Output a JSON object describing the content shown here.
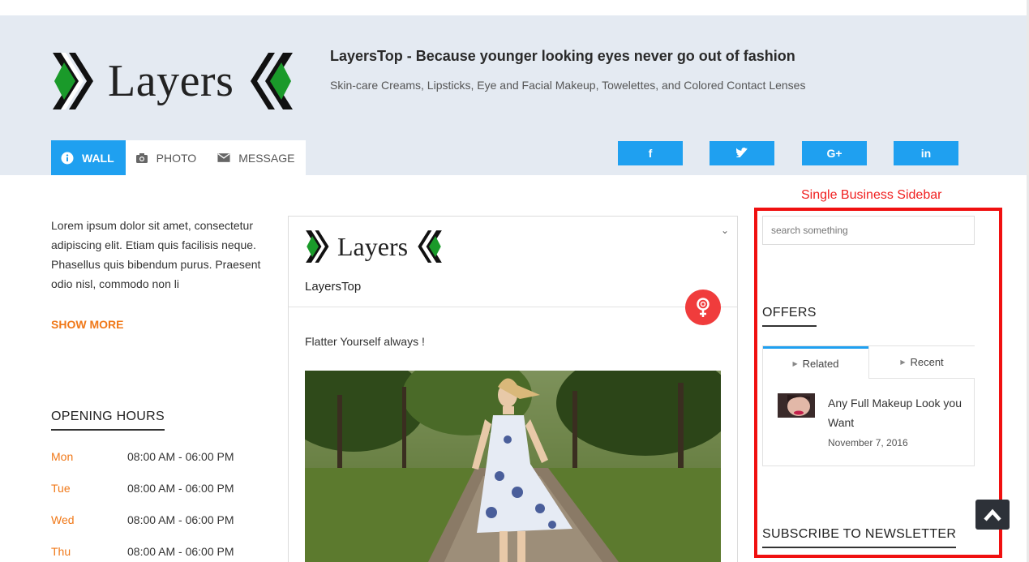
{
  "header": {
    "logo_text": "Layers",
    "tagline": "LayersTop - Because younger looking eyes never go out of fashion",
    "subtitle": "Skin-care Creams, Lipsticks, Eye and Facial Makeup, Towelettes, and Colored Contact Lenses"
  },
  "tabs": [
    {
      "label": "WALL",
      "icon": "info-icon",
      "active": true
    },
    {
      "label": "PHOTO",
      "icon": "camera-icon",
      "active": false
    },
    {
      "label": "MESSAGE",
      "icon": "envelope-icon",
      "active": false
    }
  ],
  "social": [
    {
      "label": "f",
      "icon": "facebook-icon"
    },
    {
      "label": "t",
      "icon": "twitter-icon"
    },
    {
      "label": "G+",
      "icon": "google-plus-icon"
    },
    {
      "label": "in",
      "icon": "linkedin-icon"
    }
  ],
  "intro": {
    "text": "Lorem ipsum dolor sit amet, consectetur adipiscing elit. Etiam quis facilisis neque. Phasellus quis bibendum purus. Praesent odio nisl, commodo non li",
    "show_more": "SHOW MORE"
  },
  "opening_hours": {
    "title": "OPENING HOURS",
    "rows": [
      {
        "day": "Mon",
        "time": "08:00 AM - 06:00 PM"
      },
      {
        "day": "Tue",
        "time": "08:00 AM - 06:00 PM"
      },
      {
        "day": "Wed",
        "time": "08:00 AM - 06:00 PM"
      },
      {
        "day": "Thu",
        "time": "08:00 AM - 06:00 PM"
      }
    ]
  },
  "post": {
    "logo_text": "Layers",
    "business_name": "LayersTop",
    "chevron": "⌄",
    "text": "Flatter Yourself always !"
  },
  "sidebar": {
    "label": "Single Business Sidebar",
    "search_placeholder": "search something",
    "offers_title": "OFFERS",
    "tab_related": "Related",
    "tab_recent": "Recent",
    "offer": {
      "title": "Any Full Makeup Look you Want",
      "date": "November 7, 2016"
    },
    "newsletter_title": "SUBSCRIBE TO NEWSLETTER"
  },
  "colors": {
    "accent": "#1fa0f0",
    "orange": "#f07818",
    "header_bg": "#e4eaf2",
    "highlight_red": "#f01010",
    "logo_green": "#1a9a2a"
  }
}
